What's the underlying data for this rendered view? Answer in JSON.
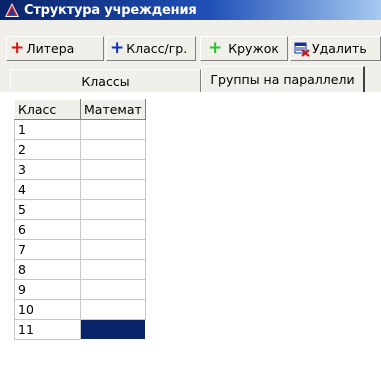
{
  "window": {
    "title": "Структура учреждения",
    "icon": "app-triangle-icon"
  },
  "toolbar": {
    "litera": {
      "label": "Литера",
      "icon": "plus-red-icon",
      "color": "#e01010"
    },
    "klass_gr": {
      "label": "Класс/гр.",
      "icon": "plus-blue-icon",
      "color": "#1030c0"
    },
    "kruzhok": {
      "label": "Кружок",
      "icon": "plus-green-icon",
      "color": "#30c030"
    },
    "udalit": {
      "label": "Удалить",
      "icon": "delete-icon"
    }
  },
  "tabs": [
    {
      "label": "Классы",
      "active": false
    },
    {
      "label": "Группы на параллели",
      "active": true
    }
  ],
  "grid": {
    "columns": [
      "Класс",
      "Математ"
    ],
    "rows": [
      {
        "class": "1",
        "math": ""
      },
      {
        "class": "2",
        "math": ""
      },
      {
        "class": "3",
        "math": ""
      },
      {
        "class": "4",
        "math": ""
      },
      {
        "class": "5",
        "math": ""
      },
      {
        "class": "6",
        "math": ""
      },
      {
        "class": "7",
        "math": ""
      },
      {
        "class": "8",
        "math": ""
      },
      {
        "class": "9",
        "math": ""
      },
      {
        "class": "10",
        "math": ""
      },
      {
        "class": "11",
        "math": "",
        "selected": true
      }
    ],
    "selection_color": "#0a246a"
  }
}
